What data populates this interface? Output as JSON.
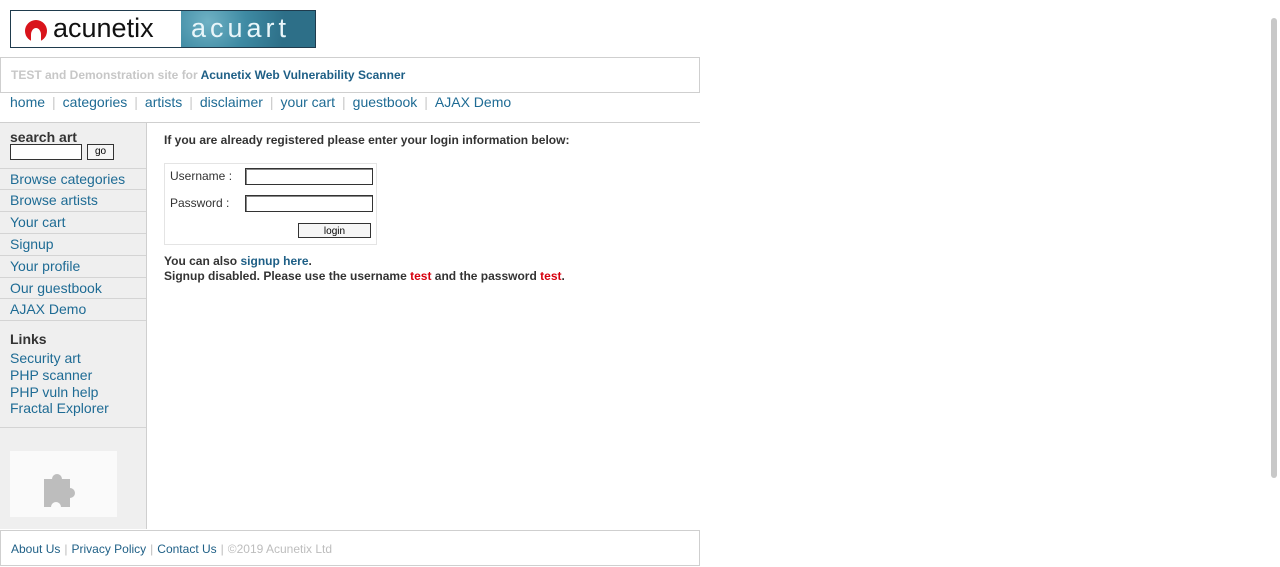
{
  "logo": {
    "left_word": "acunetix",
    "right_word": "acuart",
    "brand_red": "#d9141b"
  },
  "header": {
    "subtitle_prefix": "TEST and Demonstration site for",
    "subtitle_product": "Acunetix Web Vulnerability Scanner"
  },
  "topnav": {
    "items": [
      "home",
      "categories",
      "artists",
      "disclaimer",
      "your cart",
      "guestbook",
      "AJAX Demo"
    ],
    "separator": "|"
  },
  "sidebar": {
    "search_label": "search art",
    "search_value": "",
    "go_label": "go",
    "items": [
      "Browse categories",
      "Browse artists",
      "Your cart",
      "Signup",
      "Your profile",
      "Our guestbook",
      "AJAX Demo"
    ],
    "links_heading": "Links",
    "links": [
      "Security art",
      "PHP scanner",
      "PHP vuln help",
      "Fractal Explorer"
    ],
    "plugin_icon": "puzzle-piece-icon"
  },
  "main": {
    "prompt": "If you are already registered please enter your login information below:",
    "username_label": "Username :",
    "password_label": "Password :",
    "username_value": "",
    "password_value": "",
    "login_label": "login",
    "signup_prefix": "You can also",
    "signup_link": "signup here",
    "signup_suffix": ".",
    "disabled_text_1": "Signup disabled. Please use the username",
    "disabled_user": "test",
    "disabled_text_2": "and the password",
    "disabled_pass": "test",
    "disabled_end": "."
  },
  "footer": {
    "about": "About Us",
    "privacy": "Privacy Policy",
    "contact": "Contact Us",
    "copyright": "©2019 Acunetix Ltd",
    "separator": "|"
  },
  "colors": {
    "link": "#1e6b94",
    "highlight_red": "#d7000e",
    "sidebar_bg": "#efefef"
  }
}
